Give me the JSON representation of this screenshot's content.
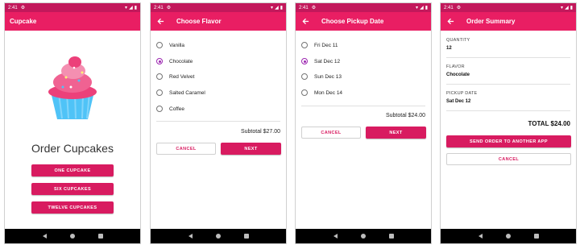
{
  "status_time": "2:41",
  "colors": {
    "primary": "#e91e63",
    "primary_dark": "#c2185b",
    "button": "#d81b60",
    "radio_accent": "#9c27b0"
  },
  "screen1": {
    "title": "Cupcake",
    "heading": "Order Cupcakes",
    "buttons": [
      "ONE CUPCAKE",
      "SIX CUPCAKES",
      "TWELVE CUPCAKES"
    ]
  },
  "screen2": {
    "title": "Choose Flavor",
    "options": [
      "Vanilla",
      "Chocolate",
      "Red Velvet",
      "Salted Caramel",
      "Coffee"
    ],
    "selected": "Chocolate",
    "subtotal": "Subtotal $27.00",
    "cancel": "CANCEL",
    "next": "NEXT"
  },
  "screen3": {
    "title": "Choose Pickup Date",
    "options": [
      "Fri Dec 11",
      "Sat Dec 12",
      "Sun Dec 13",
      "Mon Dec 14"
    ],
    "selected": "Sat Dec 12",
    "subtotal": "Subtotal $24.00",
    "cancel": "CANCEL",
    "next": "NEXT"
  },
  "screen4": {
    "title": "Order Summary",
    "quantity_label": "QUANTITY",
    "quantity_value": "12",
    "flavor_label": "FLAVOR",
    "flavor_value": "Chocolate",
    "date_label": "PICKUP DATE",
    "date_value": "Sat Dec 12",
    "total": "TOTAL $24.00",
    "send": "SEND ORDER TO ANOTHER APP",
    "cancel": "CANCEL"
  }
}
